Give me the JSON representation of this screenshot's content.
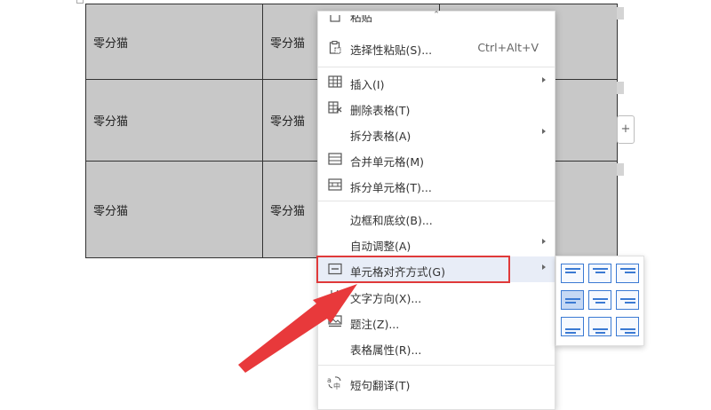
{
  "table": {
    "rows": [
      [
        "零分猫",
        "零分猫",
        ""
      ],
      [
        "零分猫",
        "零分猫",
        ""
      ],
      [
        "零分猫",
        "零分猫",
        ""
      ]
    ]
  },
  "add_column": {
    "label": "+"
  },
  "context_menu": {
    "scroll_up": "⌃",
    "partial_top_label": "粘贴",
    "items": [
      {
        "label": "选择性粘贴(S)...",
        "shortcut": "Ctrl+Alt+V",
        "icon": "paste-special-icon"
      },
      {
        "label": "插入(I)",
        "icon": "insert-table-icon",
        "submenu": true
      },
      {
        "label": "删除表格(T)",
        "icon": "delete-table-icon"
      },
      {
        "label": "拆分表格(A)",
        "icon": "",
        "submenu": true
      },
      {
        "label": "合并单元格(M)",
        "icon": "merge-cells-icon"
      },
      {
        "label": "拆分单元格(T)...",
        "icon": "split-cells-icon"
      },
      {
        "label": "边框和底纹(B)...",
        "icon": ""
      },
      {
        "label": "自动调整(A)",
        "icon": "",
        "submenu": true
      },
      {
        "label": "单元格对齐方式(G)",
        "icon": "cell-align-icon",
        "submenu": true,
        "highlighted": true
      },
      {
        "label": "文字方向(X)...",
        "icon": "text-direction-icon"
      },
      {
        "label": "题注(Z)...",
        "icon": "caption-icon"
      },
      {
        "label": "表格属性(R)...",
        "icon": ""
      },
      {
        "label": "短句翻译(T)",
        "icon": "translate-icon"
      }
    ]
  },
  "alignment_submenu": {
    "options": [
      {
        "row": "top",
        "col": "left",
        "selected": false
      },
      {
        "row": "top",
        "col": "center",
        "selected": false
      },
      {
        "row": "top",
        "col": "right",
        "selected": false
      },
      {
        "row": "middle",
        "col": "left",
        "selected": true
      },
      {
        "row": "middle",
        "col": "center",
        "selected": false
      },
      {
        "row": "middle",
        "col": "right",
        "selected": false
      },
      {
        "row": "bottom",
        "col": "left",
        "selected": false
      },
      {
        "row": "bottom",
        "col": "center",
        "selected": false
      },
      {
        "row": "bottom",
        "col": "right",
        "selected": false
      }
    ]
  },
  "colors": {
    "highlight_border": "#e03a3a",
    "accent": "#3b7ad3",
    "cell_bg": "#c8c8c8",
    "annotation_arrow": "#e8393b"
  }
}
